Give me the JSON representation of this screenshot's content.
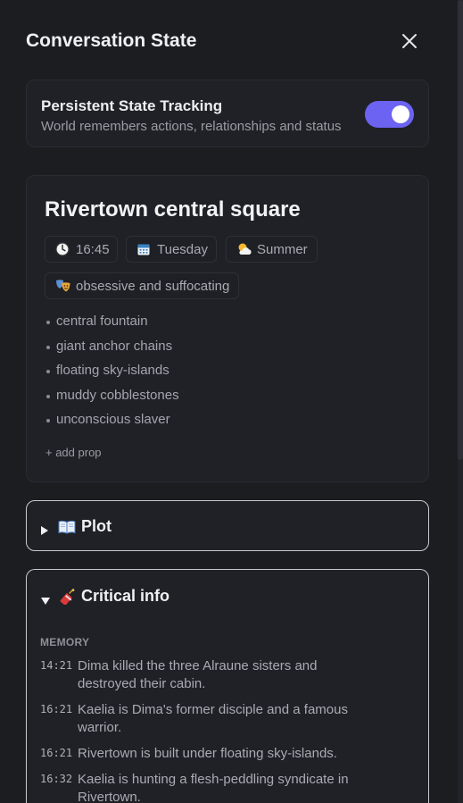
{
  "header": {
    "title": "Conversation State"
  },
  "persistent": {
    "title": "Persistent State Tracking",
    "subtitle": "World remembers actions, relationships and status",
    "enabled": true
  },
  "scene": {
    "location": "Rivertown central square",
    "time": "16:45",
    "day": "Tuesday",
    "season": "Summer",
    "mood": "obsessive and suffocating",
    "props": [
      "central fountain",
      "giant anchor chains",
      "floating sky-islands",
      "muddy cobblestones",
      "unconscious slaver"
    ],
    "add_prop_label": "+ add prop"
  },
  "plot": {
    "label": "Plot",
    "expanded": false
  },
  "critical": {
    "label": "Critical info",
    "expanded": true,
    "memory_label": "MEMORY",
    "memories": [
      {
        "time": "14:21",
        "text": "Dima killed the three Alraune sisters and destroyed their cabin."
      },
      {
        "time": "16:21",
        "text": "Kaelia is Dima's former disciple and a famous warrior."
      },
      {
        "time": "16:21",
        "text": "Rivertown is built under floating sky-islands."
      },
      {
        "time": "16:32",
        "text": "Kaelia is hunting a flesh-peddling syndicate in Rivertown."
      }
    ]
  },
  "colors": {
    "accent": "#6c63f2",
    "background": "#1c1d21",
    "card": "#1f2126"
  },
  "icons": {
    "close": "close-icon",
    "time": "clock-icon",
    "day": "calendar-icon",
    "season": "sun-behind-cloud-icon",
    "mood": "theater-masks-icon",
    "plot": "open-book-icon",
    "critical": "firecracker-icon"
  }
}
